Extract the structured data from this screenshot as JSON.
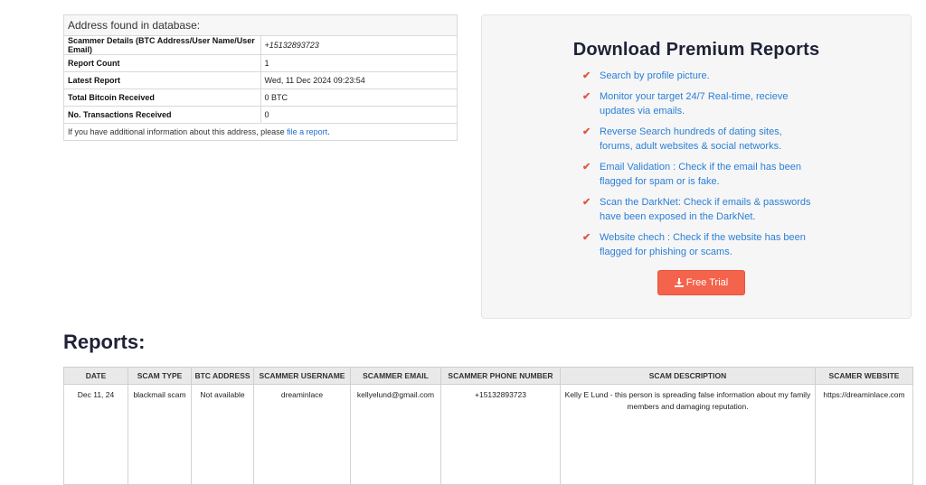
{
  "address": {
    "heading": "Address found in database:",
    "rows": [
      {
        "label": "Scammer Details (BTC Address/User Name/User Email)",
        "value": "+15132893723"
      },
      {
        "label": "Report Count",
        "value": "1"
      },
      {
        "label": "Latest Report",
        "value": "Wed, 11 Dec 2024 09:23:54"
      },
      {
        "label": "Total Bitcoin Received",
        "value": "0 BTC"
      },
      {
        "label": "No. Transactions Received",
        "value": "0"
      }
    ],
    "footer_text": "If you have additional information about this address, please ",
    "footer_link": "file a report",
    "footer_end": "."
  },
  "premium": {
    "title": "Download Premium Reports",
    "features": [
      "Search by profile picture.",
      "Monitor your target 24/7 Real-time, recieve updates via emails.",
      "Reverse Search hundreds of dating sites, forums, adult websites & social networks.",
      "Email Validation : Check if the email has been flagged for spam or is fake.",
      "Scan the DarkNet: Check if emails & passwords have been exposed in the DarkNet.",
      "Website chech : Check if the website has been flagged for phishing or scams."
    ],
    "check_icon": "check-icon",
    "button_label": "Free Trial",
    "button_icon": "download-icon",
    "accent_color": "#f4634c",
    "link_color": "#2b7fd6"
  },
  "reports": {
    "title": "Reports:",
    "columns": [
      "DATE",
      "SCAM TYPE",
      "BTC ADDRESS",
      "SCAMMER USERNAME",
      "SCAMMER EMAIL",
      "SCAMMER PHONE NUMBER",
      "SCAM DESCRIPTION",
      "SCAMER WEBSITE"
    ],
    "rows": [
      [
        "Dec 11, 24",
        "blackmail scam",
        "Not available",
        "dreaminlace",
        "kellyelund@gmail.com",
        "+15132893723",
        "Kelly E Lund - this person is spreading false information about my family members and damaging reputation.",
        "https://dreaminlace.com"
      ]
    ]
  }
}
